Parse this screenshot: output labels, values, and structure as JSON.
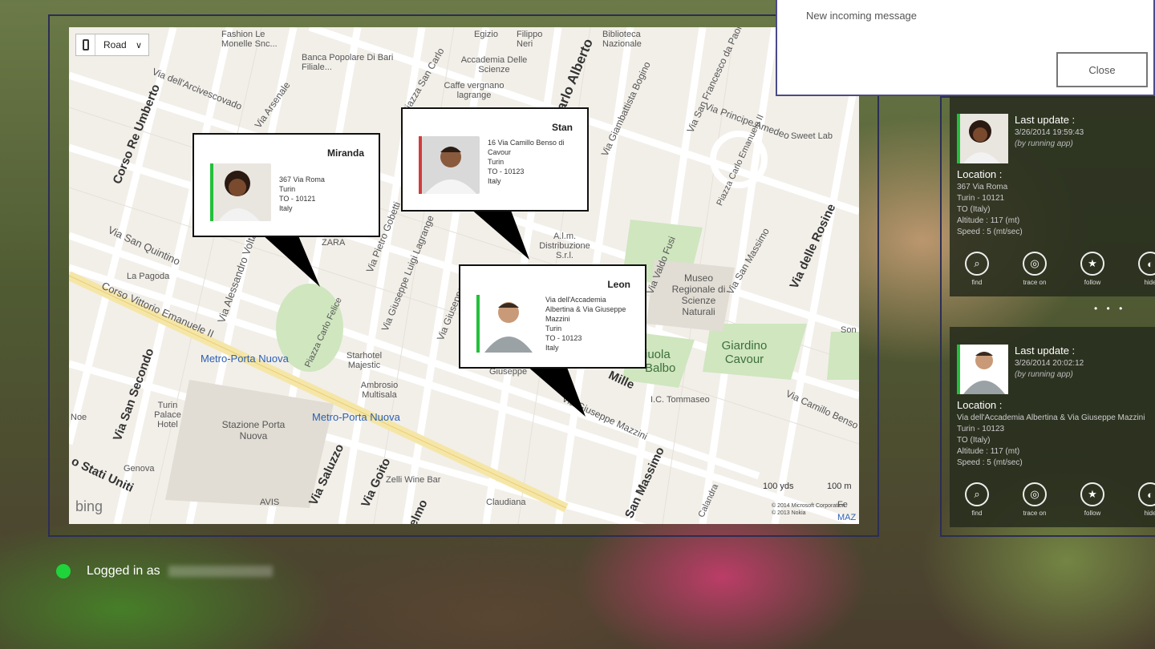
{
  "toast": {
    "message": "New incoming message",
    "close_label": "Close"
  },
  "map": {
    "type_selector": "Road",
    "bing_logo": "bing",
    "scale_yards": "100 yds",
    "scale_meters": "100 m",
    "copyright_line1": "© 2014 Microsoft Corporation",
    "copyright_line2": "© 2013 Nokia",
    "labels": {
      "corso_re_umberto": "Corso Re Umberto",
      "via_san_quintino": "Via San Quintino",
      "corso_vittorio": "Corso Vittorio Emanuele II",
      "via_san_secondo": "Via San Secondo",
      "stati_uniti": "o Stati Uniti",
      "via_alessandro_volta": "Via Alessandro Volta",
      "via_dellarcivescovado": "Via dell'Arcivescovado",
      "via_arsenale": "Via Arsenale",
      "piazza_san_carlo": "Piazza San Carlo",
      "via_carlo_alberto": "Carlo Alberto",
      "via_pietro_gobetti": "Via Pietro Gobetti",
      "via_giuseppe_luigi_lagrange": "Via Giuseppe Luigi Lagrange",
      "via_giuseppe_verdi": "Via Giuseppe",
      "via_valdo_fusi": "Via Valdo Fusi",
      "via_san_massimo": "Via San Massimo",
      "via_delle_rosine": "Via delle Rosine",
      "via_principe_amedeo": "Via Principe Amedeo",
      "via_san_francesco": "Via San Francesco da Paola",
      "via_giambattista_bogino": "Via Giambattista Bogino",
      "piazza_carlo_emanuele": "Piazza Carlo Emanuele II",
      "via_giuseppe_mazzini": "Via Giuseppe Mazzini",
      "via_camillo_benso": "Via Camillo Benso",
      "via_saluzzo": "Via Saluzzo",
      "via_goito": "Via Goito",
      "san_massimo": "San Massimo",
      "piazza_carlo_felice": "Piazza Carlo Felice",
      "metro_porta_nuova_1": "Metro-Porta Nuova",
      "metro_porta_nuova_2": "Metro-Porta Nuova",
      "stazione_porta_nuova": "Stazione Porta Nuova",
      "museo": "Museo Regionale di Scienze Naturali",
      "giardino_cavour": "Giardino Cavour",
      "aiuola_balbo": "iuola Balbo",
      "fashion": "Fashion Le Monelle Snc...",
      "banca": "Banca Popolare Di Bari Filiale...",
      "egizio": "Egizio",
      "filippo_neri": "Filippo Neri",
      "biblioteca": "Biblioteca Nazionale",
      "accademia": "Accademia Delle Scienze",
      "caffe": "Caffe vergnano lagrange",
      "sweet_lab": "Sweet Lab",
      "zara": "ZARA",
      "la_pagoda": "La Pagoda",
      "starhotel": "Starhotel Majestic",
      "ambrosio": "Ambrosio Multisala",
      "turin_palace": "Turin Palace Hotel",
      "genova": "Genova",
      "zelli": "Zelli Wine Bar",
      "avis": "AVIS",
      "claudiana": "Claudiana",
      "tommaseo": "I.C. Tommaseo",
      "alm": "A.l.m. Distribuzione S.r.l.",
      "noe": "Noe",
      "son": "Son",
      "mille": "Mille",
      "giuseppe": "Giuseppe",
      "calandra": "Calandra",
      "elmo": "elmo",
      "maz": "MAZ",
      "f": "Fe"
    }
  },
  "pins": [
    {
      "name": "Miranda",
      "address": [
        "367 Via Roma",
        "Turin",
        "TO - 10121",
        "Italy"
      ]
    },
    {
      "name": "Stan",
      "address": [
        "16 Via Camillo Benso di",
        "Cavour",
        "Turin",
        "TO - 10123",
        "Italy"
      ]
    },
    {
      "name": "Leon",
      "address": [
        "Via dell'Accademia",
        "Albertina & Via Giuseppe",
        "Mazzini",
        "Turin",
        "TO - 10123",
        "Italy"
      ]
    }
  ],
  "cards": [
    {
      "last_update_label": "Last update :",
      "date": "3/26/2014 19:59:43",
      "source": "(by running app)",
      "location_label": "Location :",
      "lines": [
        "367 Via Roma",
        "Turin - 10121",
        "TO (Italy)",
        "Altitude : 117 (mt)",
        "Speed : 5 (mt/sec)"
      ],
      "actions": [
        "find",
        "trace on",
        "follow",
        "hide"
      ]
    },
    {
      "last_update_label": "Last update :",
      "date": "3/26/2014 20:02:12",
      "source": "(by running app)",
      "location_label": "Location :",
      "lines": [
        "Via dell'Accademia Albertina & Via Giuseppe Mazzini",
        "Turin - 10123",
        "TO (Italy)",
        "Altitude : 117 (mt)",
        "Speed : 5 (mt/sec)"
      ],
      "actions": [
        "find",
        "trace on",
        "follow",
        "hide"
      ]
    }
  ],
  "pager_dots": "• •   •",
  "status": {
    "logged_in": "Logged in as"
  },
  "colors": {
    "online": "#1fd43a",
    "pin_green": "#22c03a",
    "pin_red": "#d23c3c",
    "frame": "#2b2d55"
  },
  "icons": {
    "find": "search-icon",
    "trace": "trace-icon",
    "follow": "runner-icon",
    "hide": "hide-icon"
  }
}
